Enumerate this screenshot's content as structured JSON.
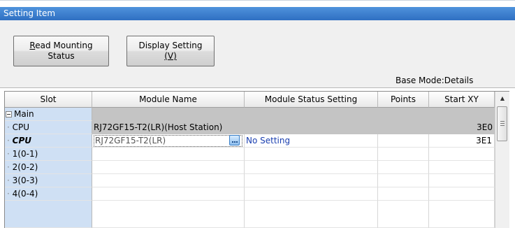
{
  "window": {
    "title": "Setting Item"
  },
  "toolbar": {
    "read_mounting": {
      "mnemonic": "R",
      "line1_rest": "ead Mounting",
      "line2": "Status"
    },
    "display_setting": {
      "line1": "Display Setting",
      "line2": "(V)"
    },
    "base_mode": "Base Mode:Details"
  },
  "grid": {
    "columns": [
      "Slot",
      "Module Name",
      "Module Status Setting",
      "Points",
      "Start XY"
    ],
    "rows": [
      {
        "slot": "Main",
        "module": "",
        "status": "",
        "points": "",
        "start": ""
      },
      {
        "slot": "CPU",
        "module": "RJ72GF15-T2(LR)(Host Station)",
        "status": "",
        "points": "",
        "start": "3E0"
      },
      {
        "slot": "CPU",
        "module": "RJ72GF15-T2(LR)",
        "status": "No Setting",
        "points": "",
        "start": "3E1"
      },
      {
        "slot": "1(0-1)",
        "module": "",
        "status": "",
        "points": "",
        "start": ""
      },
      {
        "slot": "2(0-2)",
        "module": "",
        "status": "",
        "points": "",
        "start": ""
      },
      {
        "slot": "3(0-3)",
        "module": "",
        "status": "",
        "points": "",
        "start": ""
      },
      {
        "slot": "4(0-4)",
        "module": "",
        "status": "",
        "points": "",
        "start": ""
      }
    ]
  },
  "colors": {
    "title_bar": "#3a7cd0",
    "slot_column": "#cfe0f4",
    "host_row": "#c4c4c4",
    "status_link": "#1a3fb0"
  },
  "icons": {
    "tree_toggle": "minus-box-icon",
    "browse": "ellipsis-icon",
    "scroll_up": "arrow-up-icon"
  }
}
